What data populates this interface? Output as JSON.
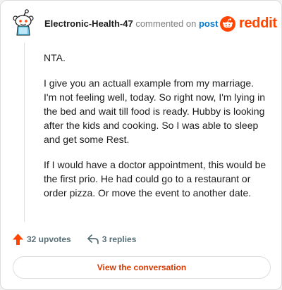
{
  "comment": {
    "username": "Electronic-Health-47",
    "action_text": "commented on",
    "target_link": "post",
    "paragraphs": [
      "NTA.",
      "I give you an actuall example from my marriage. I'm not feeling well, today. So right now, I'm lying in the bed and wait till food is ready. Hubby is looking after the kids and cooking. So I was able to sleep and get some Rest.",
      "If I would have a doctor appointment, this would be the first prio. He had could go to a restaurant or order pizza. Or move the event to another date."
    ]
  },
  "brand": {
    "wordmark": "reddit",
    "color": "#ff4500"
  },
  "actions": {
    "upvotes": "32 upvotes",
    "replies": "3 replies"
  },
  "cta": {
    "label": "View the conversation"
  },
  "icons": {
    "avatar": "snoo-avatar-icon",
    "brand": "reddit-logo-icon",
    "upvote": "upvote-arrow-icon",
    "reply": "reply-arrow-icon"
  },
  "colors": {
    "accent": "#ff4500",
    "link": "#0079d3",
    "cta_text": "#d93a00",
    "meta_text": "#576f76"
  }
}
